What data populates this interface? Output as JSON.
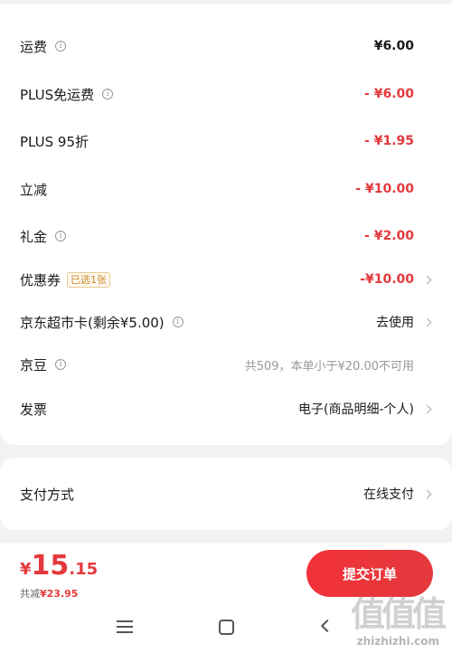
{
  "fees": [
    {
      "label": "运费",
      "info": true,
      "tag": null,
      "value": "¥6.00",
      "style": "black",
      "chevron": false
    },
    {
      "label": "PLUS免运费",
      "info": true,
      "tag": null,
      "value": "- ¥6.00",
      "style": "red",
      "chevron": false
    },
    {
      "label": "PLUS 95折",
      "info": false,
      "tag": null,
      "value": "- ¥1.95",
      "style": "red",
      "chevron": false
    },
    {
      "label": "立减",
      "info": false,
      "tag": null,
      "value": "- ¥10.00",
      "style": "red",
      "chevron": false
    },
    {
      "label": "礼金",
      "info": true,
      "tag": null,
      "value": "- ¥2.00",
      "style": "red",
      "chevron": false
    },
    {
      "label": "优惠券",
      "info": false,
      "tag": "已选1张",
      "value": "-¥10.00",
      "style": "red",
      "chevron": true
    },
    {
      "label": "京东超市卡(剩余¥5.00)",
      "info": true,
      "tag": null,
      "value": "去使用",
      "style": "normal",
      "chevron": true
    },
    {
      "label": "京豆",
      "info": true,
      "tag": null,
      "value": "共509，本单小于¥20.00不可用",
      "style": "gray",
      "chevron": false
    },
    {
      "label": "发票",
      "info": false,
      "tag": null,
      "value": "电子(商品明细-个人)",
      "style": "normal",
      "chevron": true
    }
  ],
  "payment": {
    "label": "支付方式",
    "value": "在线支付"
  },
  "footer": {
    "currency": "¥",
    "total_int": "15",
    "total_dec": ".15",
    "saved_label": "共减",
    "saved_amount": "¥23.95",
    "submit_label": "提交订单"
  },
  "watermark": {
    "logo": "值值值",
    "text": "zhizhizhi.com"
  },
  "colors": {
    "accent": "#e4393c",
    "tag": "#c88a2e"
  },
  "icons": {
    "info": "info-circle-icon",
    "chevron": "chevron-right-icon"
  }
}
